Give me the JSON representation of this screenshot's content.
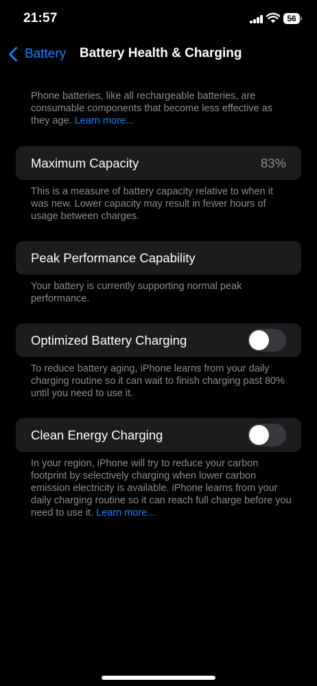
{
  "status_bar": {
    "time": "21:57",
    "battery_level": "56"
  },
  "nav": {
    "back_label": "Battery",
    "title": "Battery Health & Charging"
  },
  "intro": {
    "text": "Phone batteries, like all rechargeable batteries, are consumable components that become less effective as they age.",
    "link": "Learn more..."
  },
  "max_capacity": {
    "label": "Maximum Capacity",
    "value": "83%",
    "description": "This is a measure of battery capacity relative to when it was new. Lower capacity may result in fewer hours of usage between charges."
  },
  "peak_performance": {
    "label": "Peak Performance Capability",
    "description": "Your battery is currently supporting normal peak performance."
  },
  "optimized_charging": {
    "label": "Optimized Battery Charging",
    "enabled": false,
    "description": "To reduce battery aging, iPhone learns from your daily charging routine so it can wait to finish charging past 80% until you need to use it."
  },
  "clean_energy": {
    "label": "Clean Energy Charging",
    "enabled": false,
    "description": "In your region, iPhone will try to reduce your carbon footprint by selectively charging when lower carbon emission electricity is available. iPhone learns from your daily charging routine so it can reach full charge before you need to use it.",
    "link": "Learn more..."
  },
  "colors": {
    "accent": "#0a84ff",
    "background": "#000000",
    "cell": "#1c1c1e",
    "secondary_text": "#8e8e93",
    "toggle_off": "#39393d"
  },
  "icons": {
    "back": "chevron-left-icon",
    "signal": "cellular-signal-icon",
    "wifi": "wifi-icon",
    "battery": "battery-icon"
  }
}
